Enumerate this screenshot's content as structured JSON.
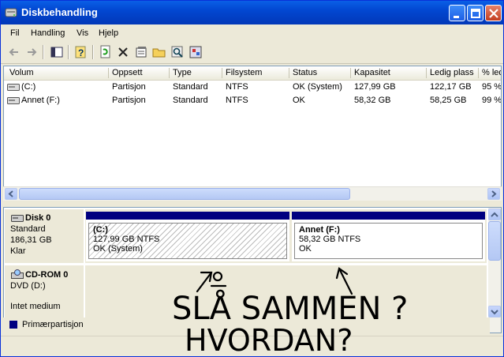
{
  "window": {
    "title": "Diskbehandling"
  },
  "menu": [
    "Fil",
    "Handling",
    "Vis",
    "Hjelp"
  ],
  "toolbar_icons": [
    "back-icon",
    "forward-icon",
    "console-tree-icon",
    "help-icon",
    "refresh-icon",
    "delete-icon",
    "properties-icon",
    "open-icon",
    "explore-icon",
    "snap-in-icon"
  ],
  "list": {
    "columns": [
      "Volum",
      "Oppsett",
      "Type",
      "Filsystem",
      "Status",
      "Kapasitet",
      "Ledig plass",
      "% led"
    ],
    "rows": [
      [
        "(C:)",
        "Partisjon",
        "Standard",
        "NTFS",
        "OK (System)",
        "127,99 GB",
        "122,17 GB",
        "95 %"
      ],
      [
        "Annet (F:)",
        "Partisjon",
        "Standard",
        "NTFS",
        "OK",
        "58,32 GB",
        "58,25 GB",
        "99 %"
      ]
    ]
  },
  "disks": [
    {
      "name": "Disk 0",
      "type": "Standard",
      "size": "186,31 GB",
      "state": "Klar",
      "partitions": [
        {
          "name": "(C:)",
          "fs": "127,99 GB NTFS",
          "status": "OK (System)"
        },
        {
          "name": "Annet  (F:)",
          "fs": "58,32 GB NTFS",
          "status": "OK"
        }
      ]
    },
    {
      "name": "CD-ROM 0",
      "type": "DVD (D:)",
      "state": "Intet medium"
    }
  ],
  "legend": {
    "label": "Primærpartisjon",
    "color": "#000080"
  },
  "handwriting": {
    "line1": "SLÅ  SAMMEN ?",
    "line2": "HVORDAN?"
  }
}
